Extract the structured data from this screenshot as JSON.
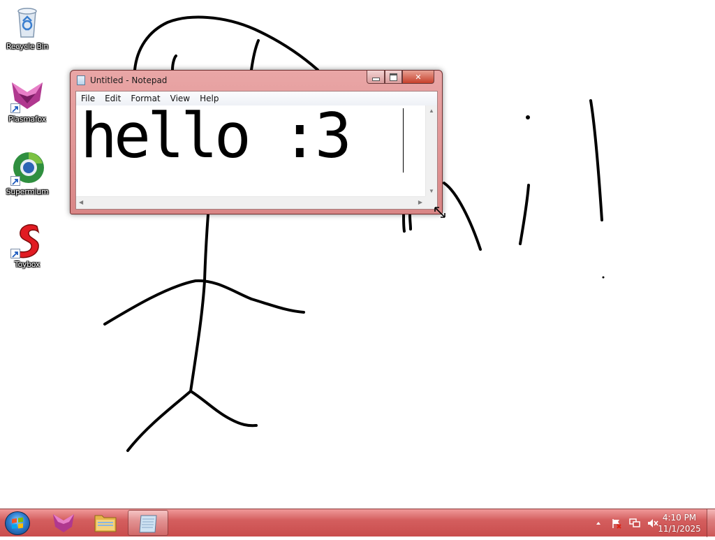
{
  "desktop": {
    "icons": [
      {
        "label": "Recycle Bin",
        "icon": "recycle-bin-icon"
      },
      {
        "label": "Plasmafox",
        "icon": "plasmafox-icon"
      },
      {
        "label": "Supermium",
        "icon": "supermium-icon"
      },
      {
        "label": "Toybox",
        "icon": "toybox-icon"
      }
    ]
  },
  "notepad": {
    "title": "Untitled - Notepad",
    "menu": [
      "File",
      "Edit",
      "Format",
      "View",
      "Help"
    ],
    "content": "hello :3",
    "controls": {
      "minimize": "minimize-icon",
      "maximize": "maximize-icon",
      "close": "close-icon"
    }
  },
  "taskbar": {
    "pinned": [
      {
        "name": "plasmafox",
        "icon": "plasmafox-icon"
      },
      {
        "name": "explorer",
        "icon": "folder-icon"
      },
      {
        "name": "notepad",
        "icon": "notepad-icon",
        "active": true
      }
    ],
    "tray": {
      "icons": [
        "chevron-up-icon",
        "action-center-flag-icon",
        "network-icon",
        "volume-muted-icon"
      ]
    },
    "clock": {
      "time": "4:10 PM",
      "date": "11/1/2025"
    }
  },
  "colors": {
    "taskbar": "#d45e5e",
    "window_frame": "#e0a0a0",
    "close_button": "#c7412c",
    "drawing_ink": "#000000"
  }
}
